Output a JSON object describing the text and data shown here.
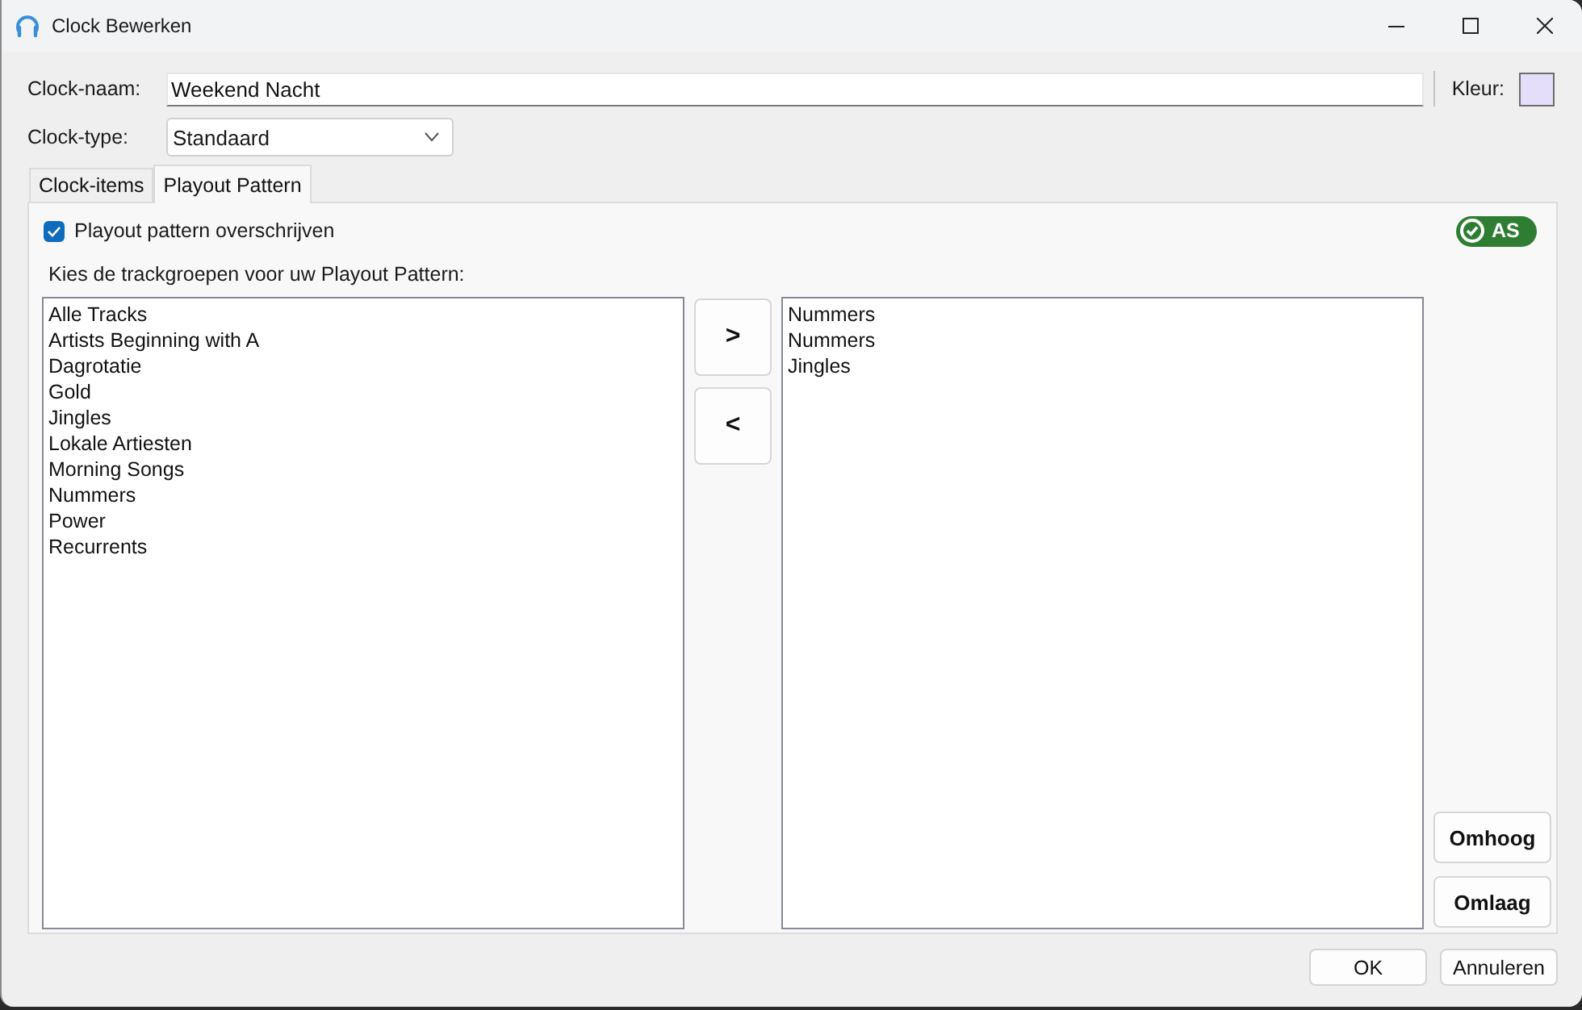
{
  "window": {
    "title": "Clock Bewerken"
  },
  "form": {
    "name_label": "Clock-naam:",
    "name_value": "Weekend Nacht",
    "color_label": "Kleur:",
    "color": "#e5defa",
    "type_label": "Clock-type:",
    "type_value": "Standaard"
  },
  "tabs": [
    {
      "label": "Clock-items",
      "selected": false
    },
    {
      "label": "Playout Pattern",
      "selected": true
    }
  ],
  "playout": {
    "override": {
      "label": "Playout pattern overschrijven",
      "checked": true
    },
    "badge": "AS",
    "prompt": "Kies de trackgroepen voor uw Playout Pattern:",
    "available": [
      {
        "label": "Alle Tracks",
        "selected": false
      },
      {
        "label": "Artists Beginning with A",
        "selected": false
      },
      {
        "label": "Dagrotatie",
        "selected": false
      },
      {
        "label": "Gold",
        "selected": false
      },
      {
        "label": "Jingles",
        "selected": false
      },
      {
        "label": "Lokale Artiesten",
        "selected": false
      },
      {
        "label": "Morning Songs",
        "selected": false
      },
      {
        "label": "Nummers",
        "selected": false
      },
      {
        "label": "Power",
        "selected": false
      },
      {
        "label": "Recurrents",
        "selected": false
      }
    ],
    "chosen": [
      {
        "label": "Nummers",
        "selected": false
      },
      {
        "label": "Nummers",
        "selected": false
      },
      {
        "label": "Jingles",
        "selected": false
      }
    ],
    "move_buttons": [
      ">",
      "<"
    ],
    "order_buttons": [
      "Omhoog",
      "Omlaag"
    ]
  },
  "buttons": [
    "OK",
    "Annuleren"
  ]
}
